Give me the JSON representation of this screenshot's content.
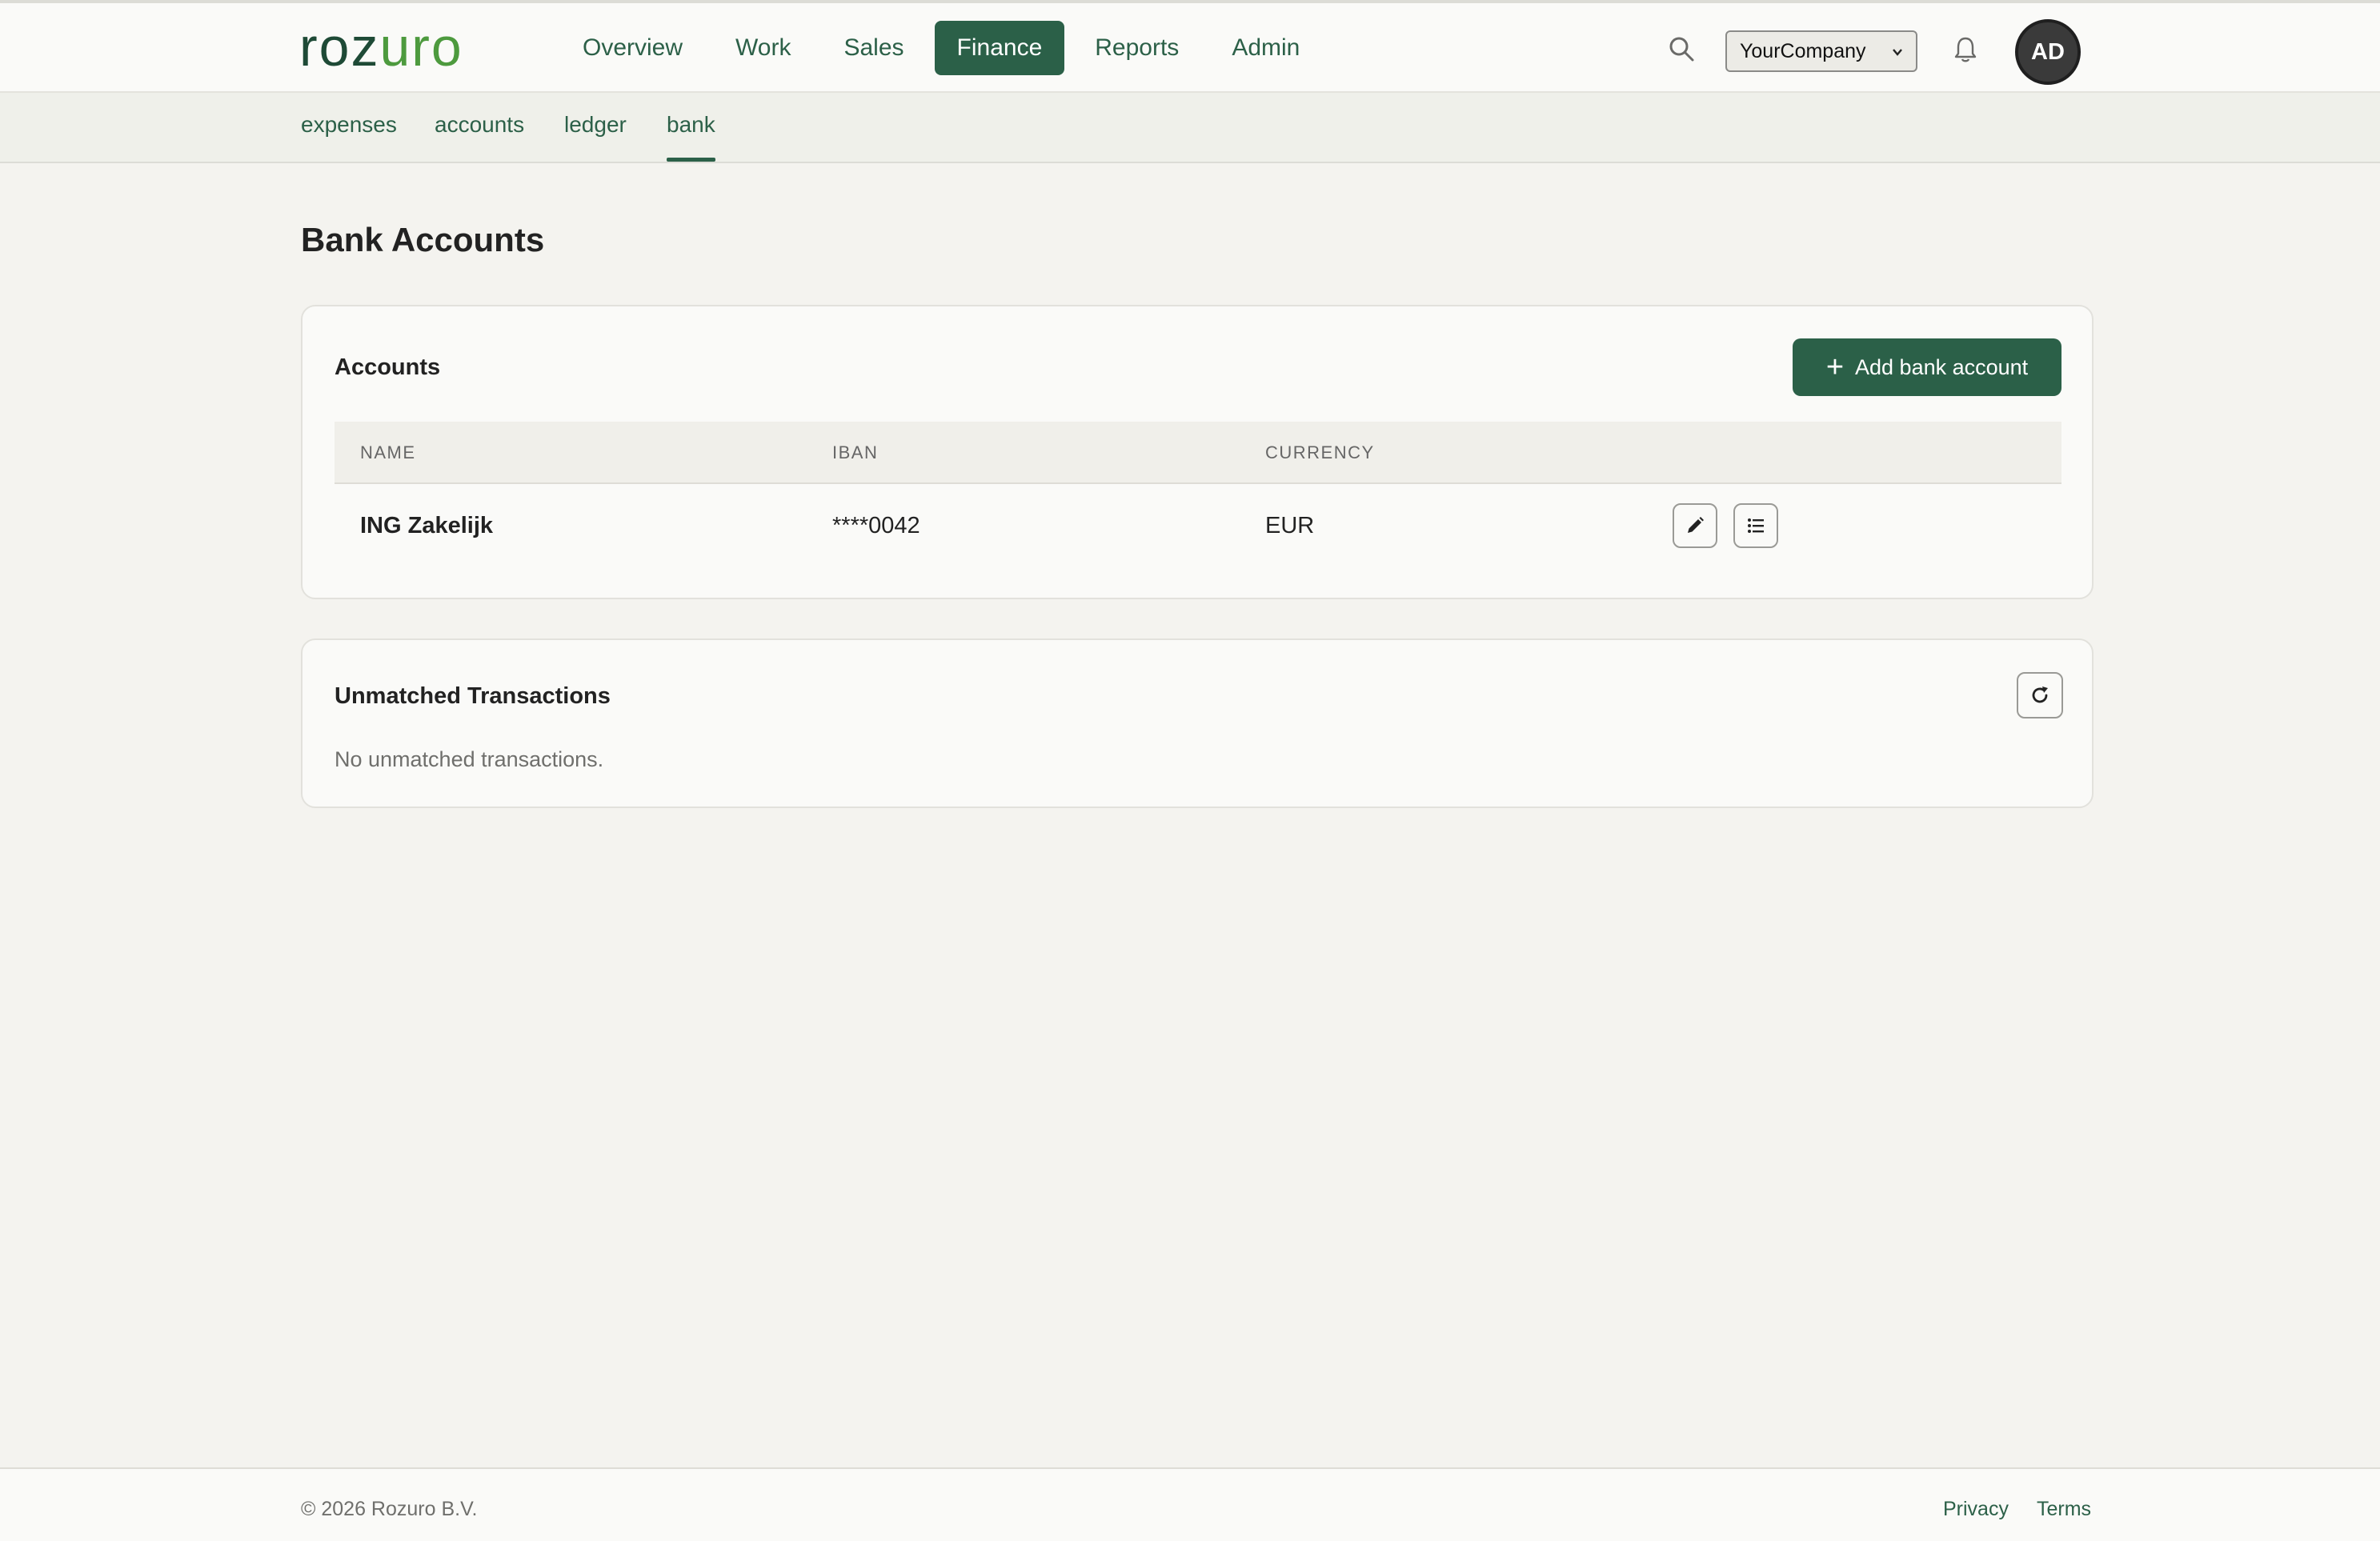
{
  "brand": {
    "logo_part1": "roz",
    "logo_part2": "uro"
  },
  "nav": {
    "items": [
      {
        "label": "Overview"
      },
      {
        "label": "Work"
      },
      {
        "label": "Sales"
      },
      {
        "label": "Finance"
      },
      {
        "label": "Reports"
      },
      {
        "label": "Admin"
      }
    ],
    "active": "Finance"
  },
  "header": {
    "company_select": "YourCompany",
    "avatar_initials": "AD"
  },
  "subnav": {
    "items": [
      {
        "label": "expenses"
      },
      {
        "label": "accounts"
      },
      {
        "label": "ledger"
      },
      {
        "label": "bank"
      }
    ],
    "active": "bank"
  },
  "page": {
    "title": "Bank Accounts"
  },
  "accounts_card": {
    "title": "Accounts",
    "add_button": "Add bank account",
    "columns": [
      "NAME",
      "IBAN",
      "CURRENCY"
    ],
    "rows": [
      {
        "name": "ING Zakelijk",
        "iban": "****0042",
        "currency": "EUR"
      }
    ]
  },
  "unmatched_card": {
    "title": "Unmatched Transactions",
    "empty_message": "No unmatched transactions."
  },
  "footer": {
    "copyright": "© 2026 Rozuro B.V.",
    "links": [
      "Privacy",
      "Terms"
    ]
  },
  "colors": {
    "brand_dark": "#2b6048",
    "brand_light": "#4d9a3e",
    "background": "#f4f3ef"
  }
}
